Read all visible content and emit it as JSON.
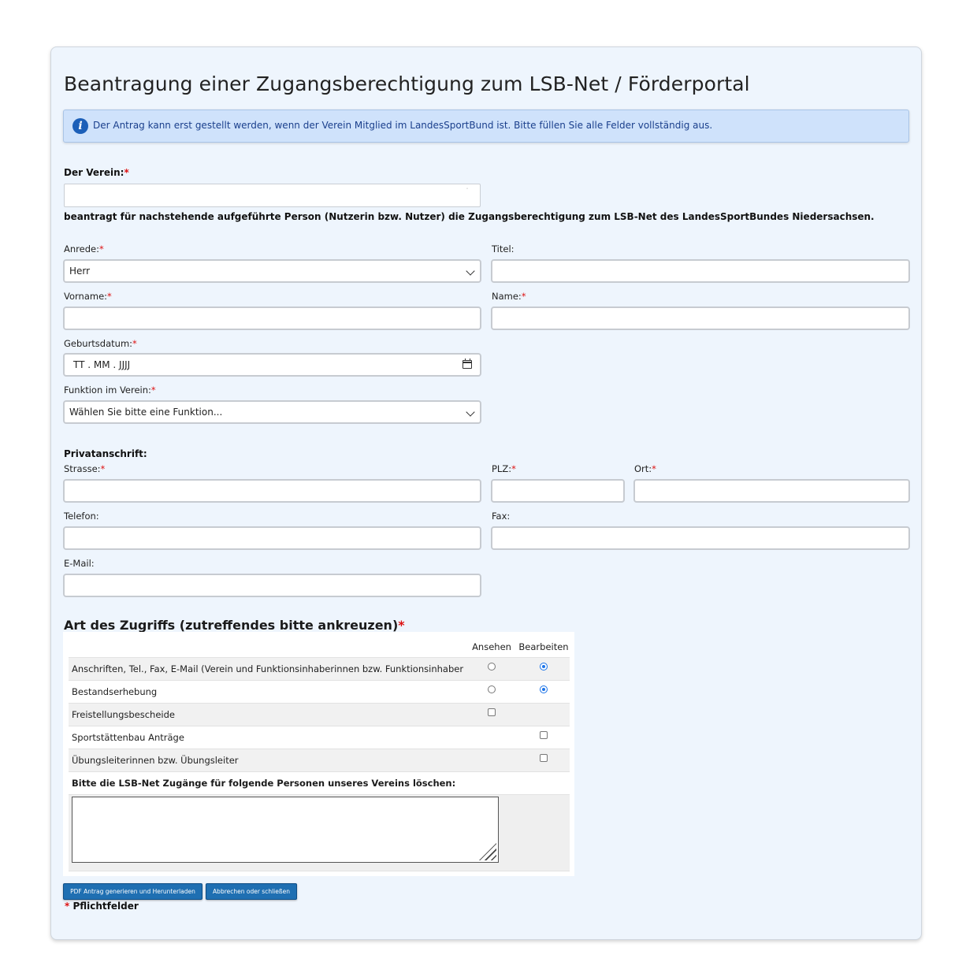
{
  "page": {
    "title": "Beantragung einer Zugangsberechtigung zum LSB-Net / Förderportal",
    "info": "Der Antrag kann erst gestellt werden, wenn der Verein Mitglied im LandesSportBund ist. Bitte füllen Sie alle Felder vollständig aus.",
    "required_mark": "*"
  },
  "verein": {
    "label": "Der Verein:",
    "value": "",
    "statement": "beantragt für nachstehende aufgeführte Person (Nutzerin bzw. Nutzer) die Zugangsberechtigung zum LSB-Net des LandesSportBundes Niedersachsen."
  },
  "form": {
    "anrede": {
      "label": "Anrede:",
      "value": "Herr"
    },
    "titel": {
      "label": "Titel:",
      "value": ""
    },
    "vorname": {
      "label": "Vorname:",
      "value": ""
    },
    "name": {
      "label": "Name:",
      "value": ""
    },
    "geburtsdatum": {
      "label": "Geburtsdatum:",
      "placeholder": "TT . MM . JJJJ"
    },
    "funktion": {
      "label": "Funktion im Verein:",
      "value": "Wählen Sie bitte eine Funktion..."
    },
    "privat_heading": "Privatanschrift:",
    "strasse": {
      "label": "Strasse:",
      "value": ""
    },
    "plz": {
      "label": "PLZ:",
      "value": ""
    },
    "ort": {
      "label": "Ort:",
      "value": ""
    },
    "telefon": {
      "label": "Telefon:",
      "value": ""
    },
    "fax": {
      "label": "Fax:",
      "value": ""
    },
    "email": {
      "label": "E-Mail:",
      "value": ""
    }
  },
  "access": {
    "heading": "Art des Zugriffs (zutreffendes bitte ankreuzen)",
    "col_view": "Ansehen",
    "col_edit": "Bearbeiten",
    "rows": [
      {
        "label": "Anschriften, Tel., Fax, E-Mail (Verein und Funktionsinhaberinnen bzw. Funktionsinhaber",
        "view": "radio-off",
        "edit": "radio-on"
      },
      {
        "label": "Bestandserhebung",
        "view": "radio-off",
        "edit": "radio-on"
      },
      {
        "label": "Freistellungsbescheide",
        "view": "checkbox-off",
        "edit": "none"
      },
      {
        "label": "Sportstättenbau Anträge",
        "view": "none",
        "edit": "checkbox-off"
      },
      {
        "label": "Übungsleiterinnen bzw. Übungsleiter",
        "view": "none",
        "edit": "checkbox-off"
      }
    ],
    "delete_label": "Bitte die LSB-Net Zugänge für folgende Personen unseres Vereins löschen:",
    "delete_value": ""
  },
  "buttons": {
    "generate": "PDF Antrag generieren und Herunterladen",
    "cancel": "Abbrechen oder schließen"
  },
  "footer": {
    "required_note": "Pflichtfelder"
  },
  "colors": {
    "accent": "#1f6fb2",
    "required": "#dd1111",
    "card_bg": "#eef5fd",
    "info_bg": "#cfe2fb"
  }
}
